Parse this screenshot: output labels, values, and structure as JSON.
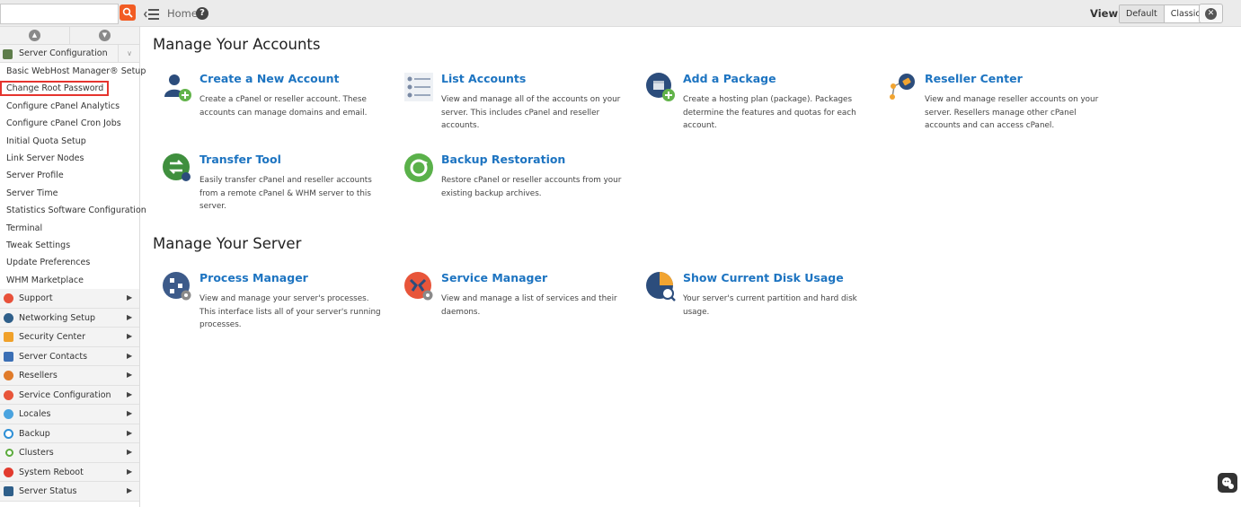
{
  "topbar": {
    "search_placeholder": "",
    "breadcrumb": "Home",
    "help_glyph": "?",
    "view_label": "View:",
    "view_options": [
      "Default",
      "Classic"
    ],
    "view_selected": "Default"
  },
  "sidebar": {
    "section": {
      "label": "Server Configuration",
      "expand_glyph": "∨"
    },
    "items": [
      "Basic WebHost Manager® Setup",
      "Change Root Password",
      "Configure cPanel Analytics",
      "Configure cPanel Cron Jobs",
      "Initial Quota Setup",
      "Link Server Nodes",
      "Server Profile",
      "Server Time",
      "Statistics Software Configuration",
      "Terminal",
      "Tweak Settings",
      "Update Preferences",
      "WHM Marketplace"
    ],
    "selected_item": "Change Root Password",
    "categories": [
      {
        "label": "Support",
        "icon": "lifebuoy-icon",
        "color": "#e8513a"
      },
      {
        "label": "Networking Setup",
        "icon": "network-icon",
        "color": "#2f5f8a"
      },
      {
        "label": "Security Center",
        "icon": "lock-icon",
        "color": "#f0a12a"
      },
      {
        "label": "Server Contacts",
        "icon": "contacts-icon",
        "color": "#3b6fb5"
      },
      {
        "label": "Resellers",
        "icon": "resellers-icon",
        "color": "#e07b2a"
      },
      {
        "label": "Service Configuration",
        "icon": "service-config-icon",
        "color": "#e8553a"
      },
      {
        "label": "Locales",
        "icon": "locales-icon",
        "color": "#4aa3df"
      },
      {
        "label": "Backup",
        "icon": "backup-icon",
        "color": "#2d8fd6"
      },
      {
        "label": "Clusters",
        "icon": "clusters-icon",
        "color": "#5bab3c"
      },
      {
        "label": "System Reboot",
        "icon": "power-icon",
        "color": "#e23b2e"
      },
      {
        "label": "Server Status",
        "icon": "server-status-icon",
        "color": "#2f5f8a"
      }
    ],
    "expand_glyph": "▶"
  },
  "main": {
    "accounts_title": "Manage Your Accounts",
    "server_title": "Manage Your Server",
    "accounts_cards": [
      {
        "title": "Create a New Account",
        "desc": "Create a cPanel or reseller account. These accounts can manage domains and email.",
        "icon": "create-account-icon"
      },
      {
        "title": "List Accounts",
        "desc": "View and manage all of the accounts on your server. This includes cPanel and reseller accounts.",
        "icon": "list-accounts-icon"
      },
      {
        "title": "Add a Package",
        "desc": "Create a hosting plan (package). Packages determine the features and quotas for each account.",
        "icon": "add-package-icon"
      },
      {
        "title": "Reseller Center",
        "desc": "View and manage reseller accounts on your server. Resellers manage other cPanel accounts and can access cPanel.",
        "icon": "reseller-center-icon"
      },
      {
        "title": "Transfer Tool",
        "desc": "Easily transfer cPanel and reseller accounts from a remote cPanel & WHM server to this server.",
        "icon": "transfer-tool-icon"
      },
      {
        "title": "Backup Restoration",
        "desc": "Restore cPanel or reseller accounts from your existing backup archives.",
        "icon": "backup-restoration-icon"
      }
    ],
    "server_cards": [
      {
        "title": "Process Manager",
        "desc": "View and manage your server's processes. This interface lists all of your server's running processes.",
        "icon": "process-manager-icon"
      },
      {
        "title": "Service Manager",
        "desc": "View and manage a list of services and their daemons.",
        "icon": "service-manager-icon"
      },
      {
        "title": "Show Current Disk Usage",
        "desc": "Your server's current partition and hard disk usage.",
        "icon": "disk-usage-icon"
      }
    ]
  },
  "colors": {
    "accent_link": "#1d74c1",
    "search_button": "#f25c23",
    "selection_outline": "#e5342e"
  }
}
